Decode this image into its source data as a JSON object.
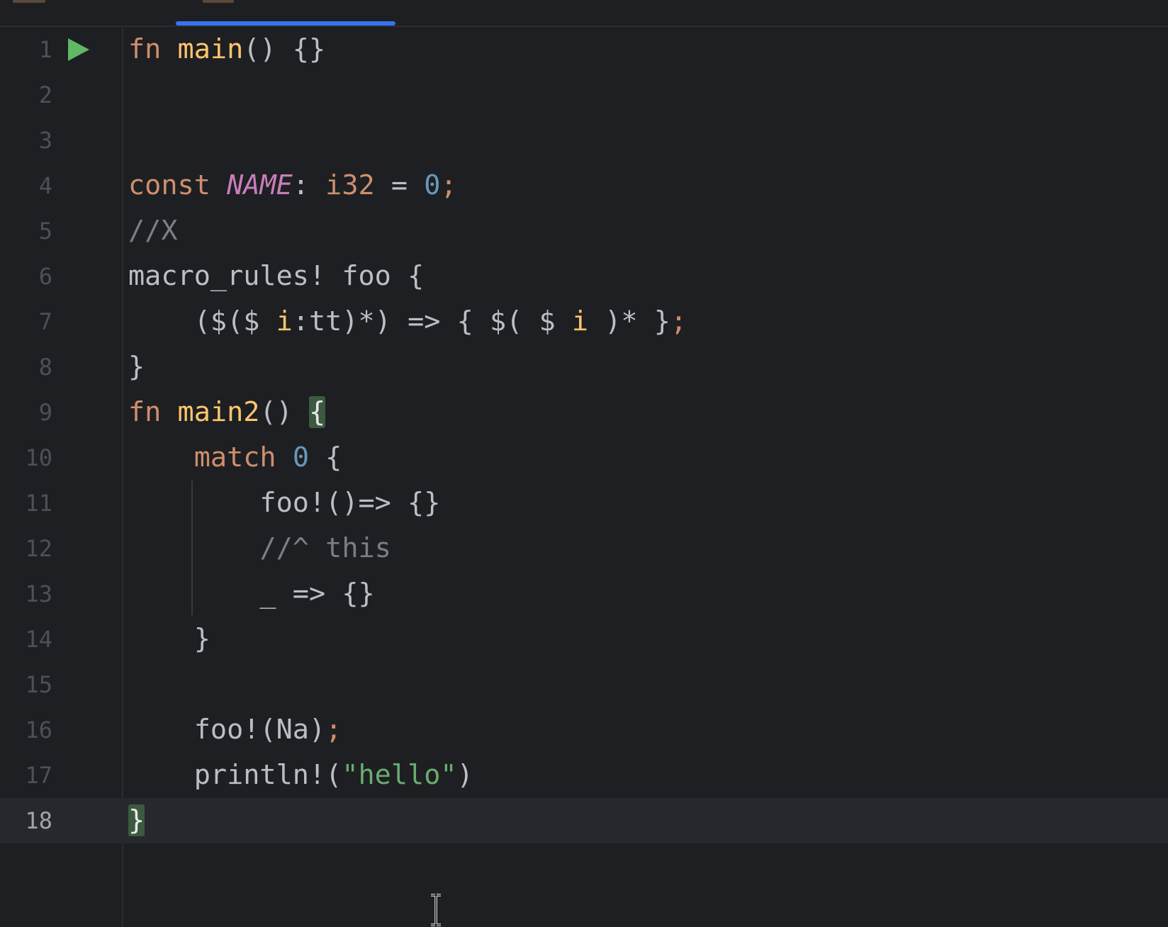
{
  "editor": {
    "current_line": "18",
    "lines": [
      {
        "number": "1",
        "tokens": [
          {
            "t": "fn",
            "c": "kw"
          },
          {
            "t": " "
          },
          {
            "t": "main",
            "c": "fnn"
          },
          {
            "t": "() {}"
          }
        ]
      },
      {
        "number": "2",
        "tokens": []
      },
      {
        "number": "3",
        "tokens": []
      },
      {
        "number": "4",
        "tokens": [
          {
            "t": "const",
            "c": "kw"
          },
          {
            "t": " "
          },
          {
            "t": "NAME",
            "c": "cst"
          },
          {
            "t": ": "
          },
          {
            "t": "i32",
            "c": "kw"
          },
          {
            "t": " = "
          },
          {
            "t": "0",
            "c": "num"
          },
          {
            "t": ";",
            "c": "kw"
          }
        ]
      },
      {
        "number": "5",
        "tokens": [
          {
            "t": "//X",
            "c": "cmt"
          }
        ]
      },
      {
        "number": "6",
        "tokens": [
          {
            "t": "macro_rules! foo {"
          }
        ]
      },
      {
        "number": "7",
        "tokens": [
          {
            "t": "    ($($ "
          },
          {
            "t": "i",
            "c": "mv"
          },
          {
            "t": ":tt)*) => { $( $ "
          },
          {
            "t": "i",
            "c": "mv"
          },
          {
            "t": " )* }"
          },
          {
            "t": ";",
            "c": "kw"
          }
        ]
      },
      {
        "number": "8",
        "tokens": [
          {
            "t": "}"
          }
        ]
      },
      {
        "number": "9",
        "tokens": [
          {
            "t": "fn",
            "c": "kw"
          },
          {
            "t": " "
          },
          {
            "t": "main2",
            "c": "fnn"
          },
          {
            "t": "() "
          },
          {
            "t": "{",
            "c": "brace-hl"
          }
        ]
      },
      {
        "number": "10",
        "tokens": [
          {
            "t": "    "
          },
          {
            "t": "match",
            "c": "kw"
          },
          {
            "t": " "
          },
          {
            "t": "0",
            "c": "num"
          },
          {
            "t": " {"
          }
        ]
      },
      {
        "number": "11",
        "tokens": [
          {
            "t": "        foo!()=> {}"
          }
        ]
      },
      {
        "number": "12",
        "tokens": [
          {
            "t": "        "
          },
          {
            "t": "//^ this",
            "c": "cmt"
          }
        ]
      },
      {
        "number": "13",
        "tokens": [
          {
            "t": "        _ => {}"
          }
        ]
      },
      {
        "number": "14",
        "tokens": [
          {
            "t": "    }"
          }
        ]
      },
      {
        "number": "15",
        "tokens": []
      },
      {
        "number": "16",
        "tokens": [
          {
            "t": "    foo!(Na)"
          },
          {
            "t": ";",
            "c": "kw"
          }
        ]
      },
      {
        "number": "17",
        "tokens": [
          {
            "t": "    println!("
          },
          {
            "t": "\"hello\"",
            "c": "str"
          },
          {
            "t": ")"
          }
        ]
      },
      {
        "number": "18",
        "tokens": [
          {
            "t": "}",
            "c": "brace-hl"
          }
        ]
      }
    ]
  },
  "icons": {
    "run": "run-icon",
    "cursor": "text-cursor-icon"
  },
  "colors": {
    "background": "#1e1f22",
    "keyword": "#cf8e6d",
    "function": "#ffc66d",
    "constant": "#c77dbb",
    "number": "#6897bb",
    "comment": "#7a7e85",
    "string": "#6aab73",
    "text": "#bcbec4",
    "tab_indicator": "#3574f0",
    "run_icon": "#5fb865",
    "brace_match": "#3b5a40"
  }
}
